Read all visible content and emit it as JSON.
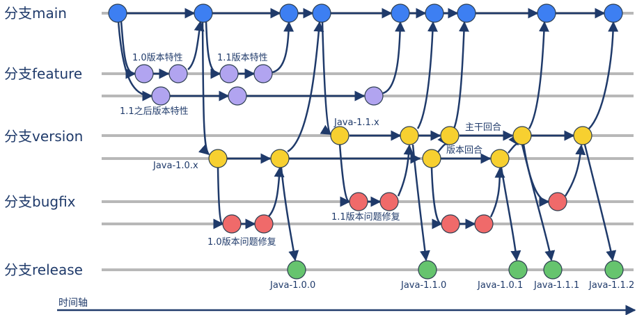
{
  "lanes": {
    "main": "分支main",
    "feature": "分支feature",
    "version": "分支version",
    "bugfix": "分支bugfix",
    "release": "分支release"
  },
  "annotations": {
    "feature_1_0": "1.0版本特性",
    "feature_1_1": "1.1版本特性",
    "feature_after_1_1": "1.1之后版本特性",
    "version_1_0_x": "Java-1.0.x",
    "version_1_1_x": "Java-1.1.x",
    "trunk_merge": "主干回合",
    "version_merge": "版本回合",
    "bugfix_1_0": "1.0版本问题修复",
    "bugfix_1_1": "1.1版本问题修复"
  },
  "release_tags": [
    "Java-1.0.0",
    "Java-1.1.0",
    "Java-1.0.1",
    "Java-1.1.1",
    "Java-1.1.2"
  ],
  "timeline_label": "时间轴",
  "colors": {
    "main": "#3d7ff2",
    "feature": "#b1a4f0",
    "version": "#f7d030",
    "bugfix": "#f06a6a",
    "release": "#66c46e",
    "edge": "#1f3a6a",
    "rail": "#b8b8b8"
  }
}
